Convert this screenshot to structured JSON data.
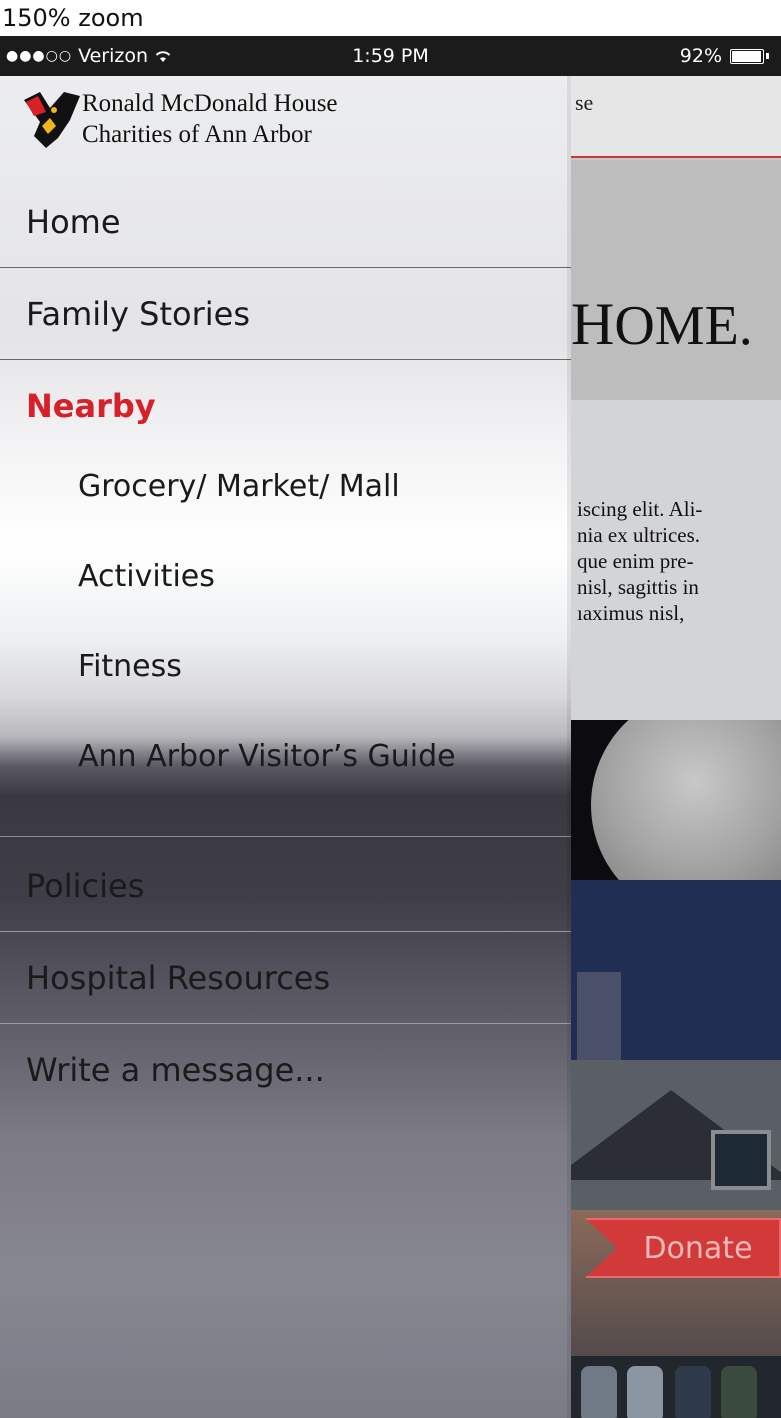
{
  "zoom": {
    "label": "150% zoom"
  },
  "status_bar": {
    "signal": "●●●○○",
    "carrier": "Verizon",
    "time": "1:59 PM",
    "battery_text": "92%",
    "battery_level": 0.92
  },
  "background_page": {
    "header_fragment": "se",
    "hero_fragment_first": "H",
    "hero_fragment_rest": "OME.",
    "body_lines": [
      "iscing elit. Ali-",
      "nia ex ultrices.",
      "que enim pre-",
      "nisl, sagittis in",
      "ıaximus nisl,"
    ],
    "donate_label": "Donate"
  },
  "menu": {
    "logo_line1": "Ronald McDonald House",
    "logo_line2": "Charities of Ann Arbor",
    "items": [
      {
        "label": "Home"
      },
      {
        "label": "Family Stories"
      },
      {
        "label": "Nearby"
      },
      {
        "label": "Grocery/ Market/ Mall"
      },
      {
        "label": "Activities"
      },
      {
        "label": "Fitness"
      },
      {
        "label": "Ann Arbor Visitor’s Guide"
      },
      {
        "label": "Policies"
      },
      {
        "label": "Hospital Resources"
      },
      {
        "label": "Write a message..."
      }
    ],
    "active_color": "#d72027"
  }
}
